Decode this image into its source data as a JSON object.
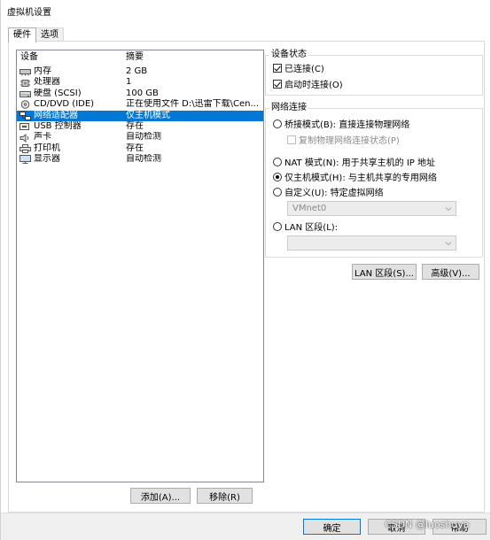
{
  "window": {
    "title": "虚拟机设置"
  },
  "tabs": [
    {
      "label": "硬件",
      "active": true
    },
    {
      "label": "选项",
      "active": false
    }
  ],
  "device_list": {
    "headers": {
      "device": "设备",
      "summary": "摘要"
    },
    "rows": [
      {
        "icon": "memory-icon",
        "device": "内存",
        "summary": "2 GB"
      },
      {
        "icon": "processor-icon",
        "device": "处理器",
        "summary": "1"
      },
      {
        "icon": "hard-disk-icon",
        "device": "硬盘 (SCSI)",
        "summary": "100 GB"
      },
      {
        "icon": "cd-dvd-icon",
        "device": "CD/DVD (IDE)",
        "summary": "正在使用文件 D:\\迅雷下载\\Cen..."
      },
      {
        "icon": "network-adapter-icon",
        "device": "网络适配器",
        "summary": "仅主机模式",
        "selected": true
      },
      {
        "icon": "usb-icon",
        "device": "USB 控制器",
        "summary": "存在"
      },
      {
        "icon": "sound-card-icon",
        "device": "声卡",
        "summary": "自动检测"
      },
      {
        "icon": "printer-icon",
        "device": "打印机",
        "summary": "存在"
      },
      {
        "icon": "display-icon",
        "device": "显示器",
        "summary": "自动检测"
      }
    ]
  },
  "buttons": {
    "add": "添加(A)...",
    "remove": "移除(R)",
    "lan_segments": "LAN 区段(S)...",
    "advanced": "高级(V)...",
    "ok": "确定",
    "cancel": "取消",
    "help": "帮助"
  },
  "device_status": {
    "title": "设备状态",
    "connected": {
      "label": "已连接(C)",
      "checked": true
    },
    "connect_at_power_on": {
      "label": "启动时连接(O)",
      "checked": true
    }
  },
  "network_connection": {
    "title": "网络连接",
    "bridged": {
      "label": "桥接模式(B): 直接连接物理网络",
      "checked": false
    },
    "replicate_state": {
      "label": "复制物理网络连接状态(P)",
      "checked": false
    },
    "nat": {
      "label": "NAT 模式(N): 用于共享主机的 IP 地址",
      "checked": false
    },
    "host_only": {
      "label": "仅主机模式(H): 与主机共享的专用网络",
      "checked": true
    },
    "custom": {
      "label": "自定义(U): 特定虚拟网络",
      "checked": false
    },
    "custom_network_value": "VMnet0",
    "lan_segment": {
      "label": "LAN 区段(L):",
      "checked": false
    },
    "lan_segment_value": ""
  },
  "watermark": "CSDN @luoshuya",
  "colors": {
    "selection": "#0078d7",
    "button_face": "#e1e1e1",
    "dialog_bg": "#f0f0f0"
  }
}
